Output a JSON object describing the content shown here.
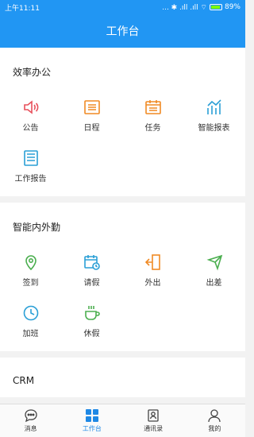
{
  "status": {
    "time": "上午11:11",
    "battery": "89%",
    "signal": "... ✱ .ıll .ıll ⌔"
  },
  "header": {
    "title": "工作台"
  },
  "sections": [
    {
      "title": "效率办公",
      "items": [
        {
          "label": "公告",
          "icon": "speaker-icon",
          "color": "#e8505b"
        },
        {
          "label": "日程",
          "icon": "list-icon",
          "color": "#f08a24"
        },
        {
          "label": "任务",
          "icon": "calendar-icon",
          "color": "#f08a24"
        },
        {
          "label": "智能报表",
          "icon": "chart-icon",
          "color": "#2a9fd6"
        },
        {
          "label": "工作报告",
          "icon": "document-icon",
          "color": "#2a9fd6"
        }
      ]
    },
    {
      "title": "智能内外勤",
      "items": [
        {
          "label": "签到",
          "icon": "location-icon",
          "color": "#4caf50"
        },
        {
          "label": "请假",
          "icon": "calendar-clock-icon",
          "color": "#2a9fd6"
        },
        {
          "label": "外出",
          "icon": "door-exit-icon",
          "color": "#f08a24"
        },
        {
          "label": "出差",
          "icon": "airplane-icon",
          "color": "#4caf50"
        },
        {
          "label": "加班",
          "icon": "clock-icon",
          "color": "#2a9fd6"
        },
        {
          "label": "休假",
          "icon": "coffee-icon",
          "color": "#4caf50"
        }
      ]
    },
    {
      "title": "CRM",
      "items": []
    }
  ],
  "tabs": [
    {
      "label": "消息",
      "icon": "chat-icon"
    },
    {
      "label": "工作台",
      "icon": "grid-icon",
      "active": true
    },
    {
      "label": "通讯录",
      "icon": "contacts-icon"
    },
    {
      "label": "我的",
      "icon": "person-icon"
    }
  ]
}
